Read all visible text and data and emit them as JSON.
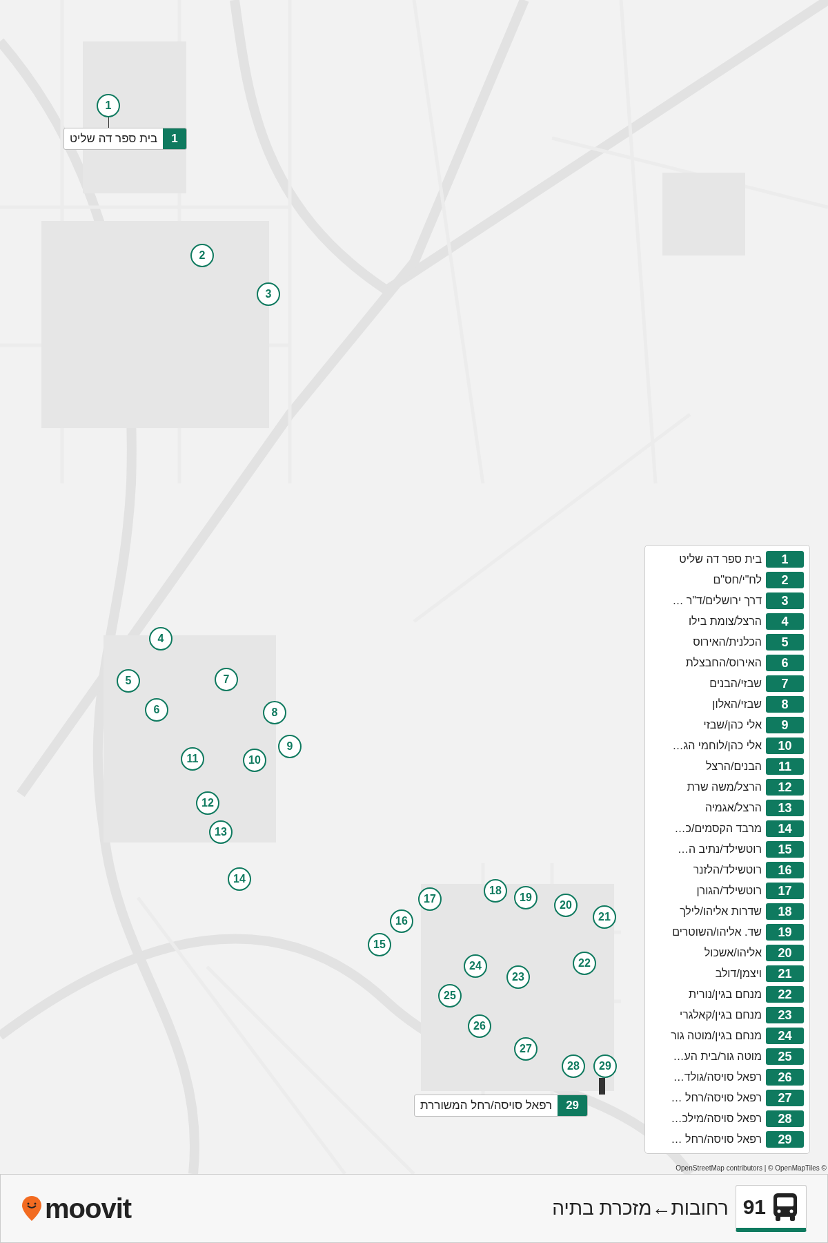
{
  "map_markers": [
    "1",
    "2",
    "3",
    "4",
    "5",
    "6",
    "7",
    "8",
    "9",
    "10",
    "11",
    "12",
    "13",
    "14",
    "15",
    "16",
    "17",
    "18",
    "19",
    "20",
    "21",
    "22",
    "23",
    "24",
    "25",
    "26",
    "27",
    "28",
    "29"
  ],
  "callouts": [
    {
      "number": "1",
      "name": "בית ספר דה שליט"
    },
    {
      "number": "29",
      "name": "רפאל סויסה/רחל המשוררת"
    }
  ],
  "stops": [
    {
      "number": "1",
      "name": "בית ספר דה שליט"
    },
    {
      "number": "2",
      "name": "לח\"י/חס\"ם"
    },
    {
      "number": "3",
      "name": "דרך ירושלים/ד\"ר …"
    },
    {
      "number": "4",
      "name": "הרצל/צומת בילו"
    },
    {
      "number": "5",
      "name": "הכלנית/האירוס"
    },
    {
      "number": "6",
      "name": "האירוס/החבצלת"
    },
    {
      "number": "7",
      "name": "שבזי/הבנים"
    },
    {
      "number": "8",
      "name": "שבזי/האלון"
    },
    {
      "number": "9",
      "name": "אלי כהן/שבזי"
    },
    {
      "number": "10",
      "name": "אלי כהן/לוחמי הג…"
    },
    {
      "number": "11",
      "name": "הבנים/הרצל"
    },
    {
      "number": "12",
      "name": "הרצל/משה שרת"
    },
    {
      "number": "13",
      "name": "הרצל/אגמיה"
    },
    {
      "number": "14",
      "name": "מרבד הקסמים/כ…"
    },
    {
      "number": "15",
      "name": "רוטשילד/נתיב ה…"
    },
    {
      "number": "16",
      "name": "רוטשילד/הלזנר"
    },
    {
      "number": "17",
      "name": "רוטשילד/הגורן"
    },
    {
      "number": "18",
      "name": "שדרות אליהו/לילך"
    },
    {
      "number": "19",
      "name": "שד. אליהו/השוטרים"
    },
    {
      "number": "20",
      "name": "אליהו/אשכול"
    },
    {
      "number": "21",
      "name": "ויצמן/דולב"
    },
    {
      "number": "22",
      "name": "מנחם בגין/נורית"
    },
    {
      "number": "23",
      "name": "מנחם בגין/קאלגרי"
    },
    {
      "number": "24",
      "name": "מנחם בגין/מוטה גור"
    },
    {
      "number": "25",
      "name": "מוטה גור/בית הע…"
    },
    {
      "number": "26",
      "name": "רפאל סויסה/גולד…"
    },
    {
      "number": "27",
      "name": "רפאל סויסה/רחל …"
    },
    {
      "number": "28",
      "name": "רפאל סויסה/מילכ…"
    },
    {
      "number": "29",
      "name": "רפאל סויסה/רחל …"
    }
  ],
  "attribution": "OpenStreetMap contributors | © OpenMapTiles ©",
  "route": {
    "number": "91",
    "title": "רחובות←מזכרת בתיה"
  },
  "logo": "moovit"
}
